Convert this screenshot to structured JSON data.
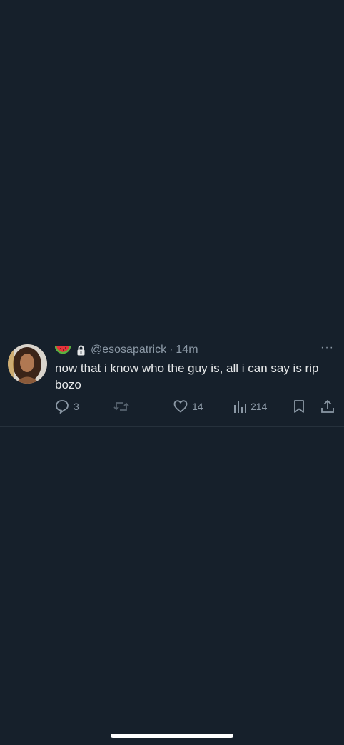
{
  "tweet": {
    "handle": "@esosapatrick",
    "separator": "·",
    "time": "14m",
    "more_label": "···",
    "text": "now that i know who the guy is, all i can say is rip bozo",
    "badge_icons": [
      "watermelon-emoji",
      "lock-icon"
    ],
    "actions": {
      "replies": "3",
      "retweets": "",
      "likes": "14",
      "views": "214"
    }
  },
  "colors": {
    "background": "#16202b",
    "text_primary": "#e7e9ea",
    "text_secondary": "#8b98a5",
    "divider": "#26313c"
  }
}
